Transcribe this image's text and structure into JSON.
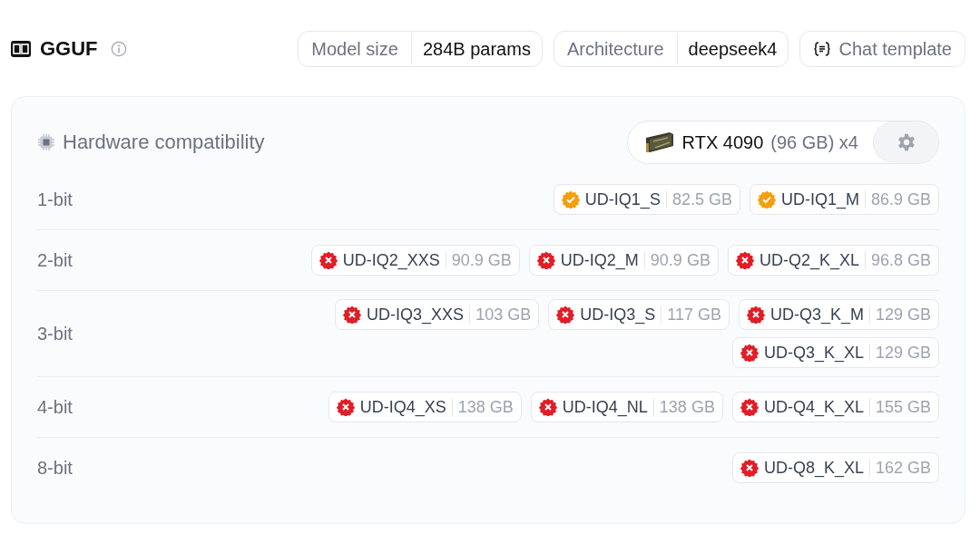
{
  "header": {
    "title": "GGUF",
    "facts": [
      {
        "label": "Model size",
        "value": "284B params"
      },
      {
        "label": "Architecture",
        "value": "deepseek4"
      }
    ],
    "chat_button": "Chat template"
  },
  "hardware": {
    "title": "Hardware compatibility",
    "gpu": {
      "name": "RTX 4090",
      "memory": "(96 GB) x4"
    },
    "rows": [
      {
        "label": "1-bit",
        "quants": [
          {
            "name": "UD-IQ1_S",
            "size": "82.5 GB",
            "kind": "fits"
          },
          {
            "name": "UD-IQ1_M",
            "size": "86.9 GB",
            "kind": "fits"
          }
        ]
      },
      {
        "label": "2-bit",
        "quants": [
          {
            "name": "UD-IQ2_XXS",
            "size": "90.9 GB",
            "kind": "too_big"
          },
          {
            "name": "UD-IQ2_M",
            "size": "90.9 GB",
            "kind": "too_big"
          },
          {
            "name": "UD-Q2_K_XL",
            "size": "96.8 GB",
            "kind": "too_big"
          }
        ]
      },
      {
        "label": "3-bit",
        "quants": [
          {
            "name": "UD-IQ3_XXS",
            "size": "103 GB",
            "kind": "too_big"
          },
          {
            "name": "UD-IQ3_S",
            "size": "117 GB",
            "kind": "too_big"
          },
          {
            "name": "UD-Q3_K_M",
            "size": "129 GB",
            "kind": "too_big"
          },
          {
            "name": "UD-Q3_K_XL",
            "size": "129 GB",
            "kind": "too_big"
          }
        ]
      },
      {
        "label": "4-bit",
        "quants": [
          {
            "name": "UD-IQ4_XS",
            "size": "138 GB",
            "kind": "too_big"
          },
          {
            "name": "UD-IQ4_NL",
            "size": "138 GB",
            "kind": "too_big"
          },
          {
            "name": "UD-Q4_K_XL",
            "size": "155 GB",
            "kind": "too_big"
          }
        ]
      },
      {
        "label": "8-bit",
        "quants": [
          {
            "name": "UD-Q8_K_XL",
            "size": "162 GB",
            "kind": "too_big"
          }
        ]
      }
    ]
  }
}
